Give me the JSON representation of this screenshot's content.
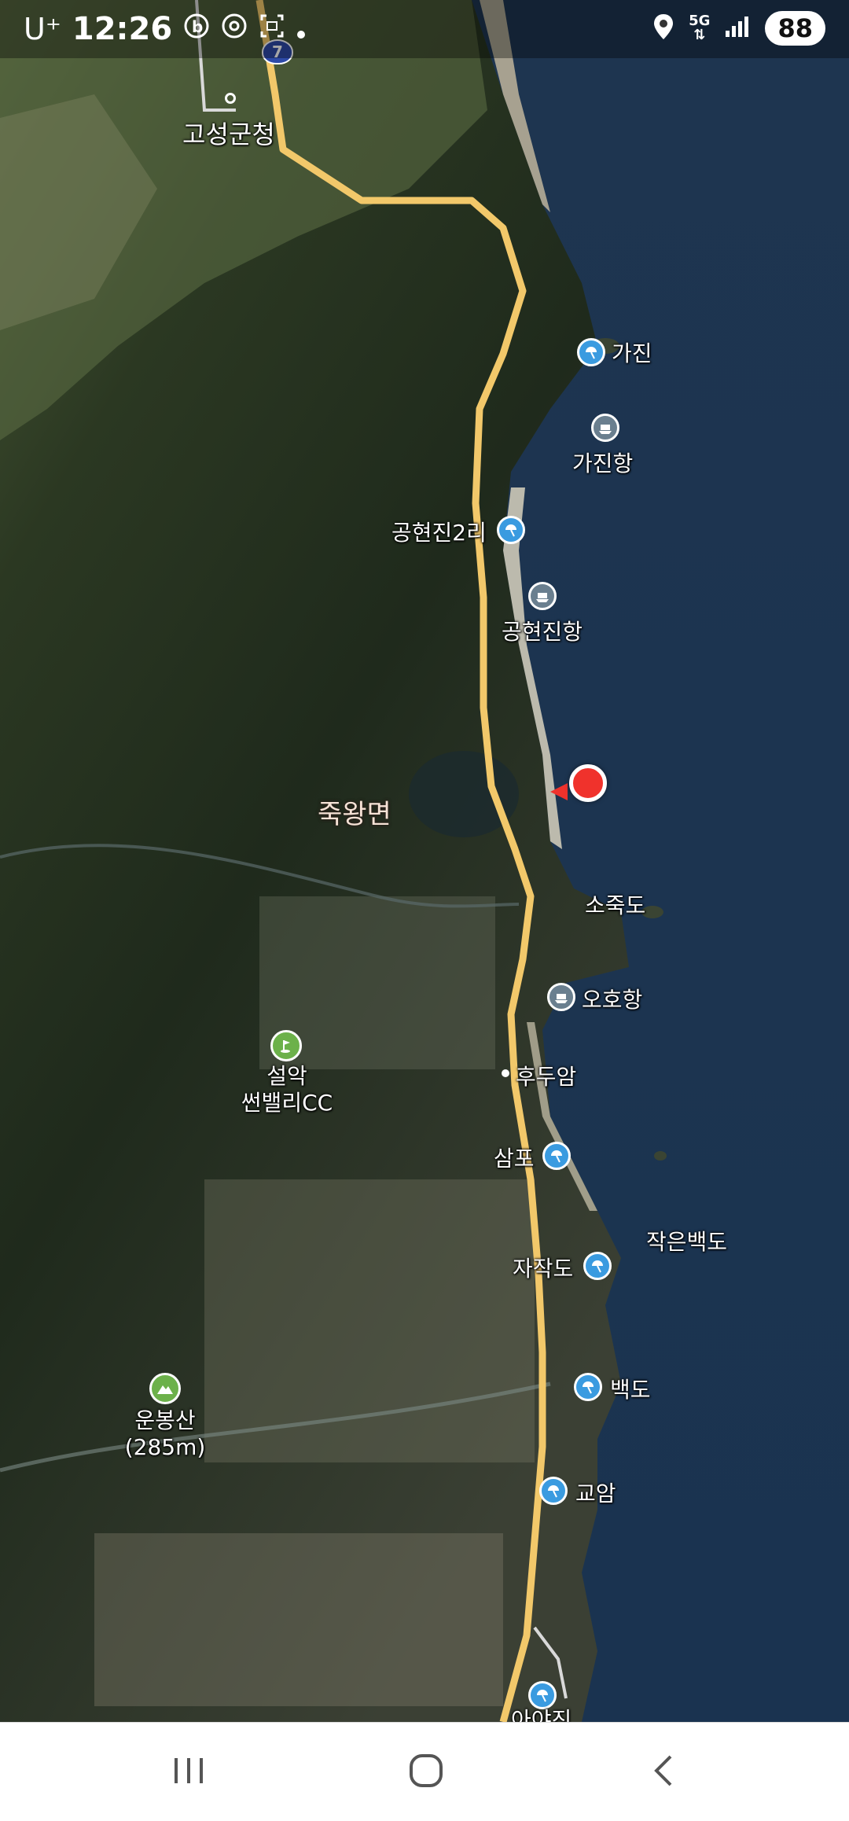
{
  "status_bar": {
    "carrier": "U⁺",
    "time": "12:26",
    "network": "5G",
    "battery": "88"
  },
  "map": {
    "region_label": "죽왕면",
    "county_office": "고성군청",
    "route_number": "7",
    "places": {
      "gajin": "가진",
      "gajin_port": "가진항",
      "gonghyeonjin2": "공현진2리",
      "gonghyeonjin_port": "공현진항",
      "sojukdo": "소죽도",
      "oho_port": "오호항",
      "hudueom": "후두암",
      "sampo": "삼포",
      "jageunbaekdo": "작은백도",
      "jajakdo": "자작도",
      "baekdo": "백도",
      "gyoam": "교암",
      "ayajin": "아야진"
    },
    "golf": {
      "line1": "설악",
      "line2": "썬밸리CC"
    },
    "mountain": {
      "name": "운봉산",
      "height": "(285m)"
    }
  },
  "nav_bar": {
    "recents_icon": "recents-icon",
    "home_icon": "home-icon",
    "back_icon": "back-icon"
  }
}
